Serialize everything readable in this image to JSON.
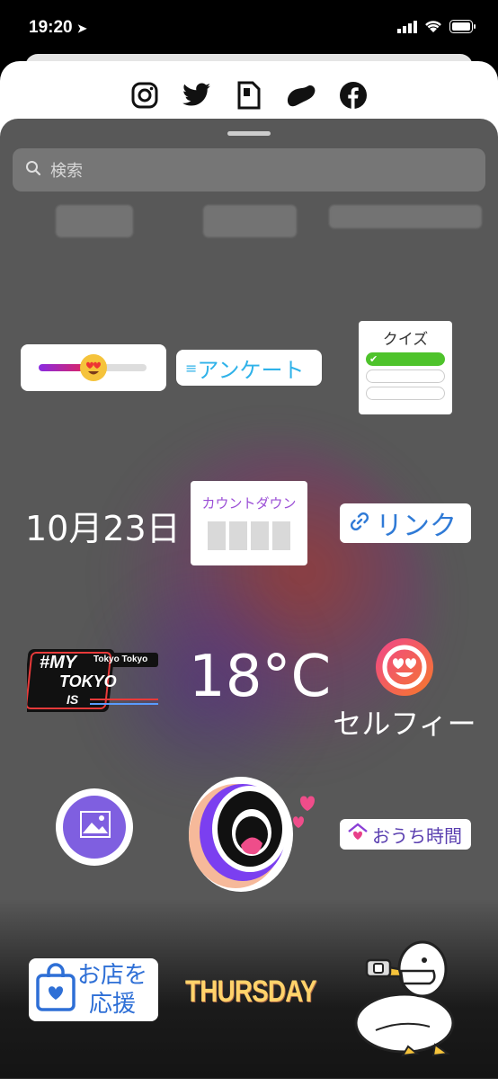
{
  "status_bar": {
    "time": "19:20"
  },
  "share_targets": [
    "instagram-icon",
    "twitter-icon",
    "document-icon",
    "messenger-icon",
    "facebook-icon"
  ],
  "search": {
    "placeholder": "検索"
  },
  "stickers": {
    "poll_label": "アンケート",
    "quiz_title": "クイズ",
    "date": "10月23日",
    "countdown_title": "カウントダウン",
    "link_label": "リンク",
    "mytokyo_line1": "#MY",
    "mytokyo_line2": "TOKYO",
    "mytokyo_line3": "IS",
    "mytokyo_badge": "Tokyo Tokyo",
    "temperature": "18°C",
    "selfie_label": "セルフィー",
    "stay_home_label": "おうち時間",
    "support_store_line1": "お店を",
    "support_store_line2": "応援",
    "day_label": "THURSDAY"
  },
  "colors": {
    "sheet_bg": "#585858",
    "poll_text": "#2fb2e9",
    "link_text": "#2f7ad6",
    "countdown_text": "#9b4fd6",
    "quiz_correct": "#4ec32b"
  }
}
